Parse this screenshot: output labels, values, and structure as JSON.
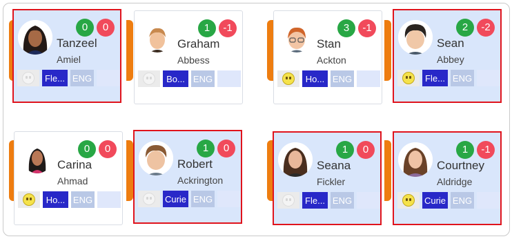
{
  "students": [
    {
      "first": "Tanzeel",
      "last": "Amiel",
      "plus": "0",
      "minus": "0",
      "class_label": "Fle...",
      "lang": "ENG",
      "smiley_on": false,
      "selected": true,
      "photo": "girl-dark-hair"
    },
    {
      "first": "Graham",
      "last": "Abbess",
      "plus": "1",
      "minus": "-1",
      "class_label": "Bo...",
      "lang": "ENG",
      "smiley_on": false,
      "selected": false,
      "photo": "boy-light-hair"
    },
    {
      "first": "Stan",
      "last": "Ackton",
      "plus": "3",
      "minus": "-1",
      "class_label": "Ho...",
      "lang": "ENG",
      "smiley_on": true,
      "selected": false,
      "photo": "boy-red-hair-glasses"
    },
    {
      "first": "Sean",
      "last": "Abbey",
      "plus": "2",
      "minus": "-2",
      "class_label": "Fle...",
      "lang": "ENG",
      "smiley_on": true,
      "selected": true,
      "photo": "boy-dark-hair"
    },
    {
      "first": "Carina",
      "last": "Ahmad",
      "plus": "0",
      "minus": "0",
      "class_label": "Ho...",
      "lang": "ENG",
      "smiley_on": true,
      "selected": false,
      "photo": "girl-long-dark-hair"
    },
    {
      "first": "Robert",
      "last": "Ackrington",
      "plus": "1",
      "minus": "0",
      "class_label": "Curie",
      "lang": "ENG",
      "smiley_on": false,
      "selected": true,
      "photo": "boy-brown-hair"
    },
    {
      "first": "Seana",
      "last": "Fickler",
      "plus": "1",
      "minus": "0",
      "class_label": "Fle...",
      "lang": "ENG",
      "smiley_on": false,
      "selected": true,
      "photo": "girl-brown-hair"
    },
    {
      "first": "Courtney",
      "last": "Aldridge",
      "plus": "1",
      "minus": "-1",
      "class_label": "Curie",
      "lang": "ENG",
      "smiley_on": true,
      "selected": true,
      "photo": "girl-long-brown-hair"
    }
  ],
  "colors": {
    "accent_orange": "#ee7d10",
    "positive": "#28a745",
    "negative": "#f14a5b",
    "selection": "#e0131c",
    "class_chip": "#2828c8"
  }
}
